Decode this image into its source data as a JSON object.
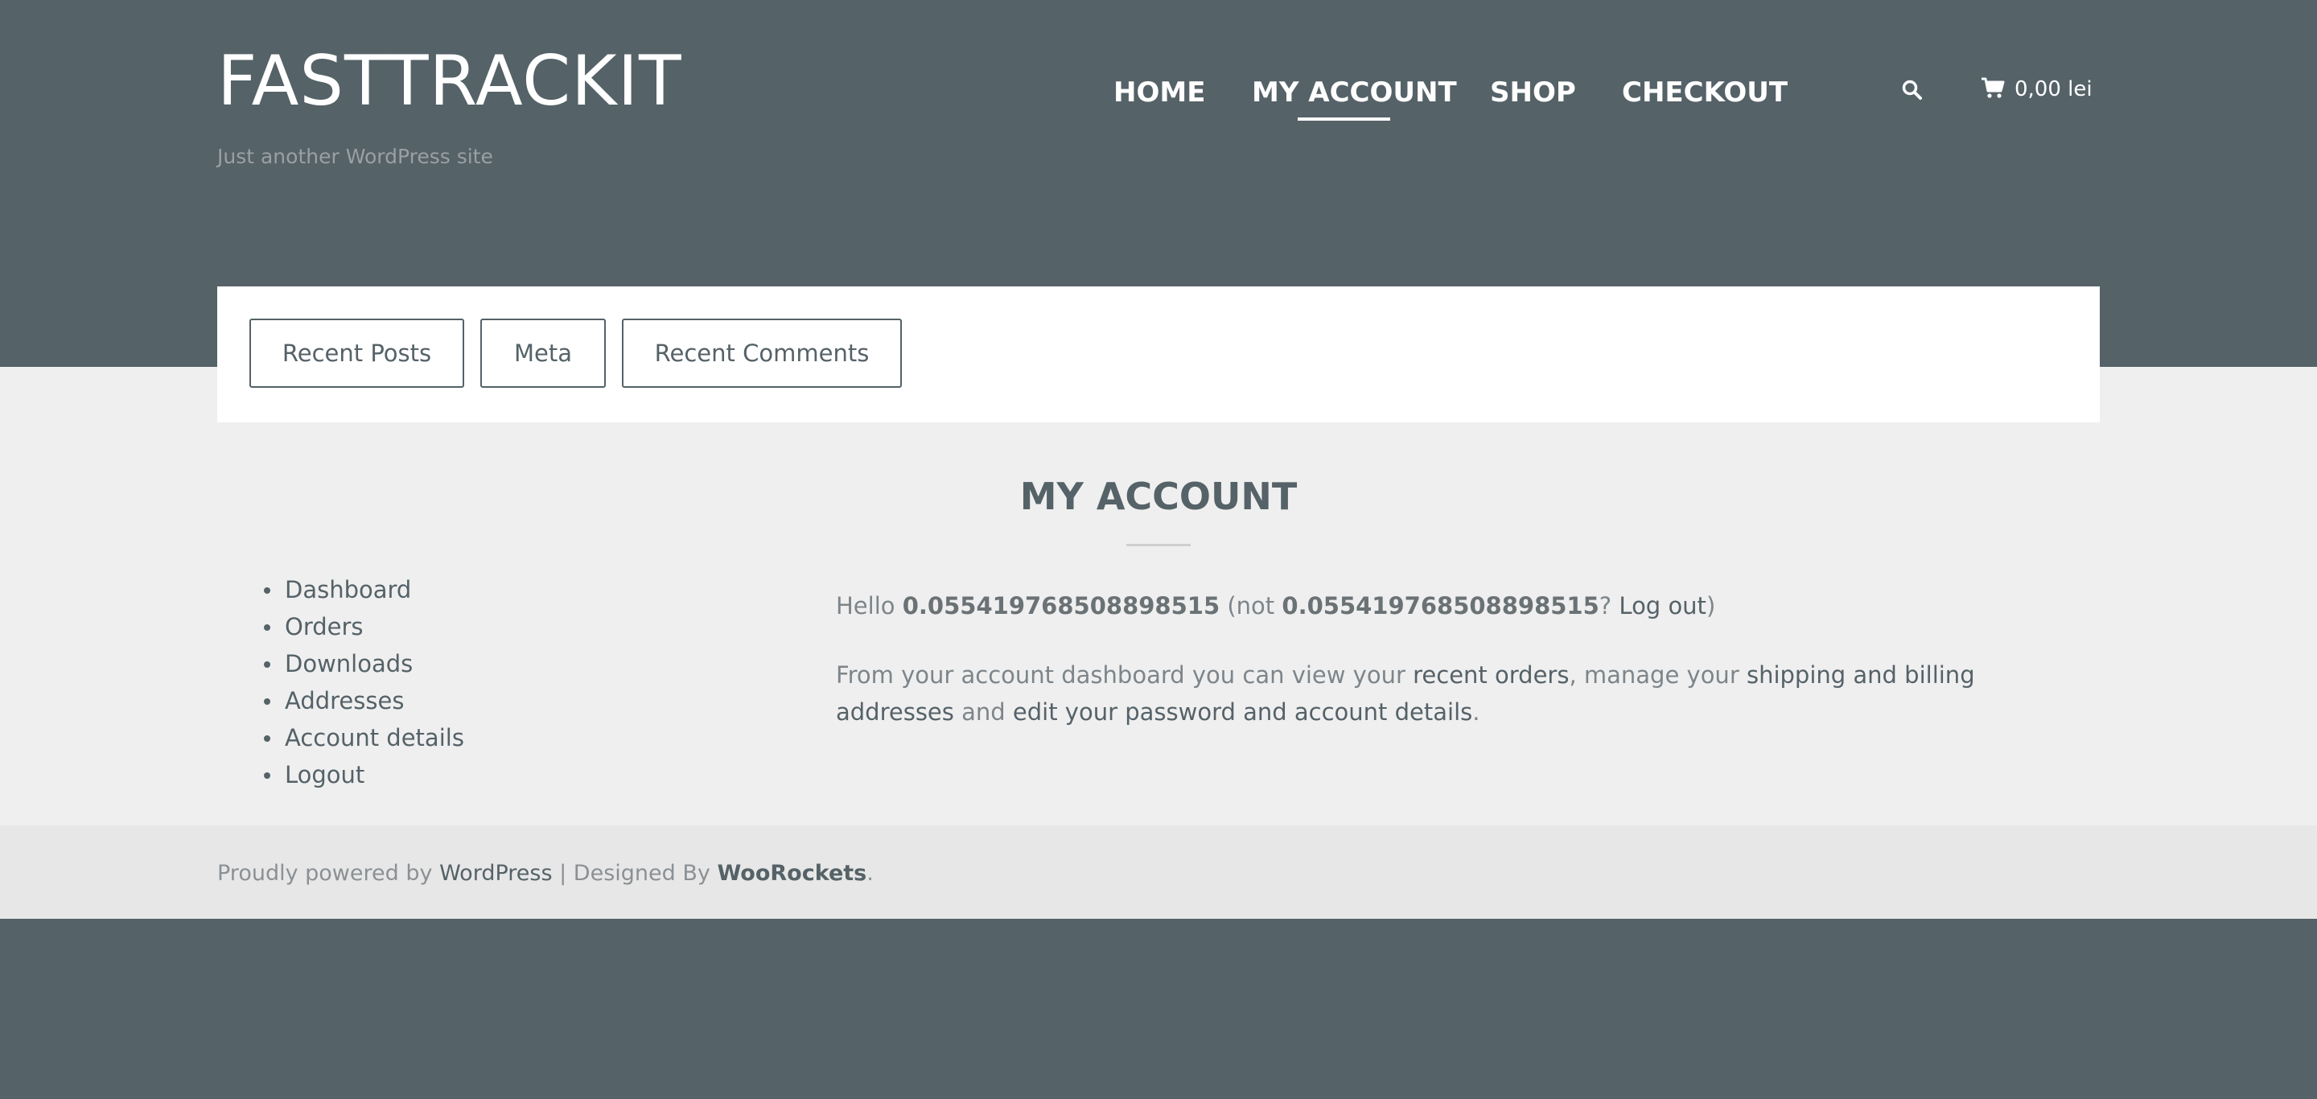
{
  "site": {
    "title": "FASTTRACKIT",
    "tagline": "Just another WordPress site"
  },
  "nav": {
    "items": [
      {
        "label": "HOME"
      },
      {
        "label": "MY ACCOUNT",
        "active": true
      },
      {
        "label": "SHOP"
      },
      {
        "label": "CHECKOUT"
      }
    ],
    "search_icon": "search-icon",
    "cart_icon": "cart-icon",
    "cart_total": "0,00 lei"
  },
  "widgets": {
    "tabs": [
      {
        "label": "Recent Posts"
      },
      {
        "label": "Meta"
      },
      {
        "label": "Recent Comments"
      }
    ]
  },
  "page": {
    "title": "MY ACCOUNT"
  },
  "account_nav": {
    "items": [
      {
        "label": "Dashboard"
      },
      {
        "label": "Orders"
      },
      {
        "label": "Downloads"
      },
      {
        "label": "Addresses"
      },
      {
        "label": "Account details"
      },
      {
        "label": "Logout"
      }
    ]
  },
  "dashboard": {
    "hello": "Hello",
    "username": "0.055419768508898515",
    "not_prefix": "(not",
    "username_again": "0.055419768508898515",
    "qmark": "?",
    "logout_link": "Log out",
    "close_paren": ")",
    "intro_1": "From your account dashboard you can view your",
    "recent_orders_link": "recent orders",
    "intro_2": ", manage your",
    "addresses_link": "shipping and billing addresses",
    "intro_3": "and",
    "edit_link": "edit your password and account details",
    "period": "."
  },
  "footer": {
    "powered_prefix": "Proudly powered by",
    "wordpress_link": "WordPress",
    "designed_prefix": "| Designed By",
    "designer_link": "WooRockets",
    "end": "."
  },
  "colors": {
    "header_bg": "#556268",
    "content_bg": "#efefef",
    "footer_bg": "#e7e7e7",
    "accent": "#556268"
  }
}
